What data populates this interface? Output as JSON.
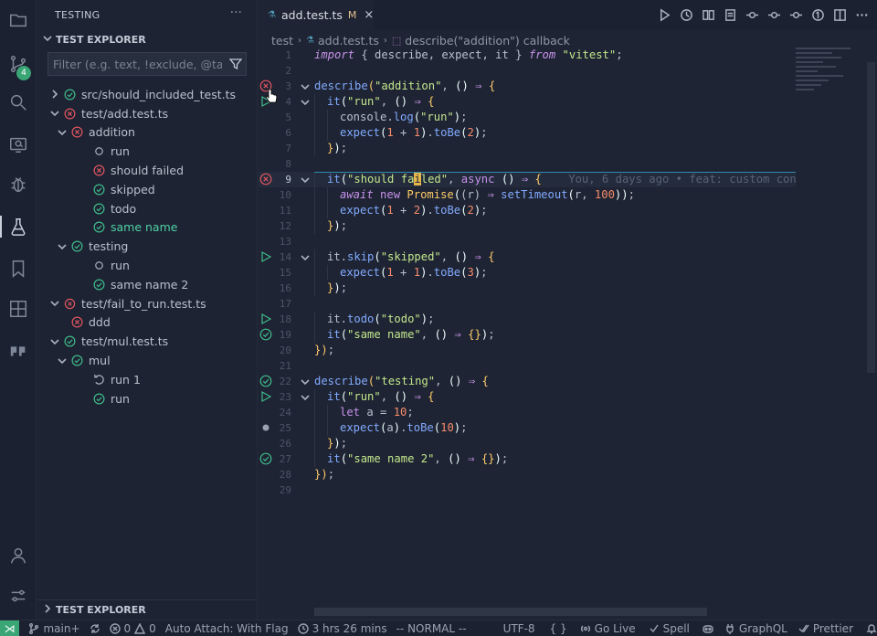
{
  "activity_bar": {
    "items": [
      "explorer-icon",
      "source-control-icon",
      "search-icon",
      "remote-explorer-icon",
      "debug-icon",
      "testing-icon",
      "bookmarks-icon",
      "extensions-icon",
      "quote-icon"
    ],
    "scm_badge": "4",
    "bottom": [
      "account-icon",
      "settings-icon"
    ]
  },
  "sidebar": {
    "title": "TESTING",
    "section": "TEST EXPLORER",
    "filter_placeholder": "Filter (e.g. text, !exclude, @tag)",
    "tree": [
      {
        "label": "src/should_included_test.ts",
        "depth": 0,
        "twisty": "right",
        "status": "pass"
      },
      {
        "label": "test/add.test.ts",
        "depth": 0,
        "twisty": "down",
        "status": "fail"
      },
      {
        "label": "addition",
        "depth": 1,
        "twisty": "down",
        "status": "fail"
      },
      {
        "label": "run",
        "depth": 2,
        "twisty": "",
        "status": "none"
      },
      {
        "label": "should failed",
        "depth": 2,
        "twisty": "",
        "status": "fail"
      },
      {
        "label": "skipped",
        "depth": 2,
        "twisty": "",
        "status": "skip"
      },
      {
        "label": "todo",
        "depth": 2,
        "twisty": "",
        "status": "skip"
      },
      {
        "label": "same name",
        "depth": 2,
        "twisty": "",
        "status": "pass",
        "highlight": true
      },
      {
        "label": "testing",
        "depth": 1,
        "twisty": "down",
        "status": "pass"
      },
      {
        "label": "run",
        "depth": 2,
        "twisty": "",
        "status": "none"
      },
      {
        "label": "same name 2",
        "depth": 2,
        "twisty": "",
        "status": "pass"
      },
      {
        "label": "test/fail_to_run.test.ts",
        "depth": 0,
        "twisty": "down",
        "status": "fail-hollow"
      },
      {
        "label": "ddd",
        "depth": 1,
        "twisty": "",
        "status": "fail"
      },
      {
        "label": "test/mul.test.ts",
        "depth": 0,
        "twisty": "down",
        "status": "pass"
      },
      {
        "label": "mul",
        "depth": 1,
        "twisty": "down",
        "status": "pass"
      },
      {
        "label": "run 1",
        "depth": 2,
        "twisty": "",
        "status": "running"
      },
      {
        "label": "run",
        "depth": 2,
        "twisty": "",
        "status": "pass"
      }
    ],
    "bottom_section": "TEST EXPLORER"
  },
  "editor": {
    "tab": {
      "name": "add.test.ts",
      "modified": "M",
      "close": "×"
    },
    "breadcrumbs": [
      "test",
      "add.test.ts",
      "describe(\"addition\") callback"
    ],
    "blame": "You, 6 days ago • feat: custom con",
    "lines": [
      {
        "n": "1",
        "gutter": "",
        "fold": "",
        "indent": 0,
        "html": [
          [
            "k",
            "import"
          ],
          [
            "v",
            " { describe, expect, it } "
          ],
          [
            "k",
            "from"
          ],
          [
            "v",
            " "
          ],
          [
            "s",
            "\"vitest\""
          ],
          [
            "v",
            ";"
          ]
        ]
      },
      {
        "n": "2",
        "gutter": "",
        "fold": "",
        "indent": 0,
        "html": []
      },
      {
        "n": "3",
        "gutter": "fail",
        "fold": "down",
        "indent": 0,
        "html": [
          [
            "f",
            "describe"
          ],
          [
            "y",
            "("
          ],
          [
            "s",
            "\"addition\""
          ],
          [
            "v",
            ", "
          ],
          [
            "c",
            "()"
          ],
          [
            "v",
            " "
          ],
          [
            "kw",
            "⇒"
          ],
          [
            "v",
            " "
          ],
          [
            "y",
            "{"
          ]
        ]
      },
      {
        "n": "4",
        "gutter": "run",
        "fold": "down",
        "indent": 1,
        "html": [
          [
            "f",
            "it"
          ],
          [
            "c",
            "("
          ],
          [
            "s",
            "\"run\""
          ],
          [
            "v",
            ", "
          ],
          [
            "c",
            "()"
          ],
          [
            "v",
            " "
          ],
          [
            "kw",
            "⇒"
          ],
          [
            "v",
            " "
          ],
          [
            "y",
            "{"
          ]
        ]
      },
      {
        "n": "5",
        "gutter": "",
        "fold": "",
        "indent": 2,
        "html": [
          [
            "v",
            "console."
          ],
          [
            "f",
            "log"
          ],
          [
            "c",
            "("
          ],
          [
            "s",
            "\"run\""
          ],
          [
            "c",
            ")"
          ],
          [
            "v",
            ";"
          ]
        ]
      },
      {
        "n": "6",
        "gutter": "",
        "fold": "",
        "indent": 2,
        "html": [
          [
            "f",
            "expect"
          ],
          [
            "c",
            "("
          ],
          [
            "n",
            "1"
          ],
          [
            "v",
            " + "
          ],
          [
            "n",
            "1"
          ],
          [
            "c",
            ")"
          ],
          [
            "v",
            "."
          ],
          [
            "f",
            "toBe"
          ],
          [
            "c",
            "("
          ],
          [
            "n",
            "2"
          ],
          [
            "c",
            ")"
          ],
          [
            "v",
            ";"
          ]
        ]
      },
      {
        "n": "7",
        "gutter": "",
        "fold": "",
        "indent": 1,
        "html": [
          [
            "y",
            "}"
          ],
          [
            "c",
            ")"
          ],
          [
            "v",
            ";"
          ]
        ]
      },
      {
        "n": "8",
        "gutter": "",
        "fold": "",
        "indent": 0,
        "html": []
      },
      {
        "n": "9",
        "gutter": "fail",
        "fold": "down",
        "indent": 1,
        "cur": true,
        "html": [
          [
            "f",
            "it"
          ],
          [
            "c",
            "("
          ],
          [
            "s",
            "\"should fa"
          ],
          [
            "y",
            "i"
          ],
          [
            "s",
            "led\""
          ],
          [
            "v",
            ", "
          ],
          [
            "kw",
            "async"
          ],
          [
            "v",
            " "
          ],
          [
            "c",
            "()"
          ],
          [
            "v",
            " "
          ],
          [
            "kw",
            "⇒"
          ],
          [
            "v",
            " "
          ],
          [
            "y",
            "{"
          ]
        ]
      },
      {
        "n": "10",
        "gutter": "",
        "fold": "",
        "indent": 2,
        "html": [
          [
            "k",
            "await"
          ],
          [
            "v",
            " "
          ],
          [
            "kw",
            "new"
          ],
          [
            "v",
            " "
          ],
          [
            "y",
            "Promise"
          ],
          [
            "c",
            "("
          ],
          [
            "v",
            "(r) "
          ],
          [
            "kw",
            "⇒"
          ],
          [
            "v",
            " "
          ],
          [
            "f",
            "setTimeout"
          ],
          [
            "c",
            "("
          ],
          [
            "v",
            "r, "
          ],
          [
            "n",
            "100"
          ],
          [
            "c",
            "))"
          ],
          [
            "v",
            ";"
          ]
        ]
      },
      {
        "n": "11",
        "gutter": "",
        "fold": "",
        "indent": 2,
        "html": [
          [
            "f",
            "expect"
          ],
          [
            "c",
            "("
          ],
          [
            "n",
            "1"
          ],
          [
            "v",
            " + "
          ],
          [
            "n",
            "2"
          ],
          [
            "c",
            ")"
          ],
          [
            "v",
            "."
          ],
          [
            "f",
            "toBe"
          ],
          [
            "c",
            "("
          ],
          [
            "n",
            "2"
          ],
          [
            "c",
            ")"
          ],
          [
            "v",
            ";"
          ]
        ]
      },
      {
        "n": "12",
        "gutter": "",
        "fold": "",
        "indent": 1,
        "html": [
          [
            "y",
            "}"
          ],
          [
            "c",
            ")"
          ],
          [
            "v",
            ";"
          ]
        ]
      },
      {
        "n": "13",
        "gutter": "",
        "fold": "",
        "indent": 0,
        "html": []
      },
      {
        "n": "14",
        "gutter": "run",
        "fold": "down",
        "indent": 1,
        "html": [
          [
            "v",
            "it."
          ],
          [
            "f",
            "skip"
          ],
          [
            "c",
            "("
          ],
          [
            "s",
            "\"skipped\""
          ],
          [
            "v",
            ", "
          ],
          [
            "c",
            "()"
          ],
          [
            "v",
            " "
          ],
          [
            "kw",
            "⇒"
          ],
          [
            "v",
            " "
          ],
          [
            "y",
            "{"
          ]
        ]
      },
      {
        "n": "15",
        "gutter": "",
        "fold": "",
        "indent": 2,
        "html": [
          [
            "f",
            "expect"
          ],
          [
            "c",
            "("
          ],
          [
            "n",
            "1"
          ],
          [
            "v",
            " + "
          ],
          [
            "n",
            "1"
          ],
          [
            "c",
            ")"
          ],
          [
            "v",
            "."
          ],
          [
            "f",
            "toBe"
          ],
          [
            "c",
            "("
          ],
          [
            "n",
            "3"
          ],
          [
            "c",
            ")"
          ],
          [
            "v",
            ";"
          ]
        ]
      },
      {
        "n": "16",
        "gutter": "",
        "fold": "",
        "indent": 1,
        "html": [
          [
            "y",
            "}"
          ],
          [
            "c",
            ")"
          ],
          [
            "v",
            ";"
          ]
        ]
      },
      {
        "n": "17",
        "gutter": "",
        "fold": "",
        "indent": 0,
        "html": []
      },
      {
        "n": "18",
        "gutter": "run",
        "fold": "",
        "indent": 1,
        "html": [
          [
            "v",
            "it."
          ],
          [
            "f",
            "todo"
          ],
          [
            "c",
            "("
          ],
          [
            "s",
            "\"todo\""
          ],
          [
            "c",
            ")"
          ],
          [
            "v",
            ";"
          ]
        ]
      },
      {
        "n": "19",
        "gutter": "pass",
        "fold": "",
        "indent": 1,
        "html": [
          [
            "f",
            "it"
          ],
          [
            "c",
            "("
          ],
          [
            "s",
            "\"same name\""
          ],
          [
            "v",
            ", "
          ],
          [
            "c",
            "()"
          ],
          [
            "v",
            " "
          ],
          [
            "kw",
            "⇒"
          ],
          [
            "v",
            " "
          ],
          [
            "y",
            "{}"
          ],
          [
            "c",
            ")"
          ],
          [
            "v",
            ";"
          ]
        ]
      },
      {
        "n": "20",
        "gutter": "",
        "fold": "",
        "indent": 0,
        "html": [
          [
            "y",
            "}"
          ],
          [
            "y",
            ")"
          ],
          [
            "v",
            ";"
          ]
        ]
      },
      {
        "n": "21",
        "gutter": "",
        "fold": "",
        "indent": 0,
        "html": []
      },
      {
        "n": "22",
        "gutter": "pass",
        "fold": "down",
        "indent": 0,
        "html": [
          [
            "f",
            "describe"
          ],
          [
            "y",
            "("
          ],
          [
            "s",
            "\"testing\""
          ],
          [
            "v",
            ", "
          ],
          [
            "c",
            "()"
          ],
          [
            "v",
            " "
          ],
          [
            "kw",
            "⇒"
          ],
          [
            "v",
            " "
          ],
          [
            "y",
            "{"
          ]
        ]
      },
      {
        "n": "23",
        "gutter": "run",
        "fold": "down",
        "indent": 1,
        "html": [
          [
            "f",
            "it"
          ],
          [
            "c",
            "("
          ],
          [
            "s",
            "\"run\""
          ],
          [
            "v",
            ", "
          ],
          [
            "c",
            "()"
          ],
          [
            "v",
            " "
          ],
          [
            "kw",
            "⇒"
          ],
          [
            "v",
            " "
          ],
          [
            "y",
            "{"
          ]
        ]
      },
      {
        "n": "24",
        "gutter": "",
        "fold": "",
        "indent": 2,
        "html": [
          [
            "kw",
            "let"
          ],
          [
            "v",
            " a = "
          ],
          [
            "n",
            "10"
          ],
          [
            "v",
            ";"
          ]
        ]
      },
      {
        "n": "25",
        "gutter": "dot",
        "fold": "",
        "indent": 2,
        "html": [
          [
            "f",
            "expect"
          ],
          [
            "c",
            "("
          ],
          [
            "v",
            "a"
          ],
          [
            "c",
            ")"
          ],
          [
            "v",
            "."
          ],
          [
            "f",
            "toBe"
          ],
          [
            "c",
            "("
          ],
          [
            "n",
            "10"
          ],
          [
            "c",
            ")"
          ],
          [
            "v",
            ";"
          ]
        ]
      },
      {
        "n": "26",
        "gutter": "",
        "fold": "",
        "indent": 1,
        "html": [
          [
            "y",
            "}"
          ],
          [
            "c",
            ")"
          ],
          [
            "v",
            ";"
          ]
        ]
      },
      {
        "n": "27",
        "gutter": "pass",
        "fold": "",
        "indent": 1,
        "html": [
          [
            "f",
            "it"
          ],
          [
            "c",
            "("
          ],
          [
            "s",
            "\"same name 2\""
          ],
          [
            "v",
            ", "
          ],
          [
            "c",
            "()"
          ],
          [
            "v",
            " "
          ],
          [
            "kw",
            "⇒"
          ],
          [
            "v",
            " "
          ],
          [
            "y",
            "{}"
          ],
          [
            "c",
            ")"
          ],
          [
            "v",
            ";"
          ]
        ]
      },
      {
        "n": "28",
        "gutter": "",
        "fold": "",
        "indent": 0,
        "html": [
          [
            "y",
            "}"
          ],
          [
            "y",
            ")"
          ],
          [
            "v",
            ";"
          ]
        ]
      },
      {
        "n": "29",
        "gutter": "",
        "fold": "",
        "indent": 0,
        "html": []
      }
    ]
  },
  "status_bar": {
    "branch": "main+",
    "errors": "0",
    "warnings": "0",
    "auto_attach": "Auto Attach: With Flag",
    "time": "3 hrs 26 mins",
    "mode": "-- NORMAL --",
    "encoding": "UTF-8",
    "braces": "{ }",
    "go_live": "Go Live",
    "spell": "Spell",
    "graphql": "GraphQL",
    "prettier": "Prettier"
  },
  "colors": {
    "accent": "#3aa676",
    "pass": "#3fb98a",
    "fail": "#e05561",
    "run": "#3fb98a",
    "current_line_border": "#2f8bb0"
  }
}
